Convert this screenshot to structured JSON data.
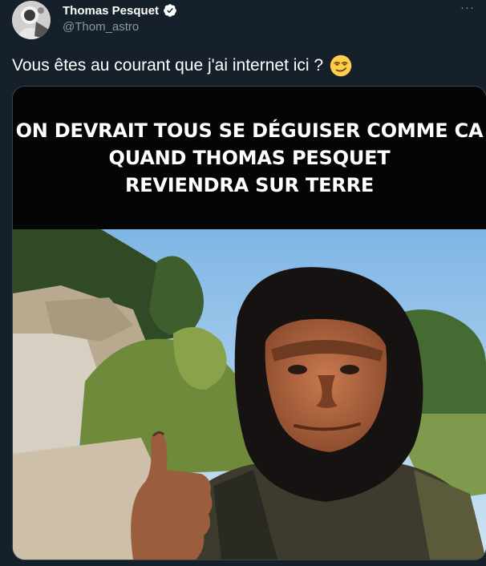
{
  "author": {
    "display_name": "Thomas Pesquet",
    "handle": "@Thom_astro",
    "verified": true
  },
  "tweet": {
    "text": "Vous êtes au courant que j'ai internet ici ?",
    "emoji": "smirking-face"
  },
  "menu": {
    "more_label": "···"
  },
  "media": {
    "caption_lines": [
      "ON DEVRAIT TOUS SE DÉGUISER COMME CA",
      "QUAND THOMAS PESQUET",
      "REVIENDRA SUR TERRE"
    ],
    "photo_subject": "person in ape mask giving thumbs up, outdoors"
  },
  "colors": {
    "background": "#15202b",
    "text": "#ffffff",
    "muted": "#8899a6",
    "verified": "#1da1f2",
    "border": "#38444d"
  }
}
